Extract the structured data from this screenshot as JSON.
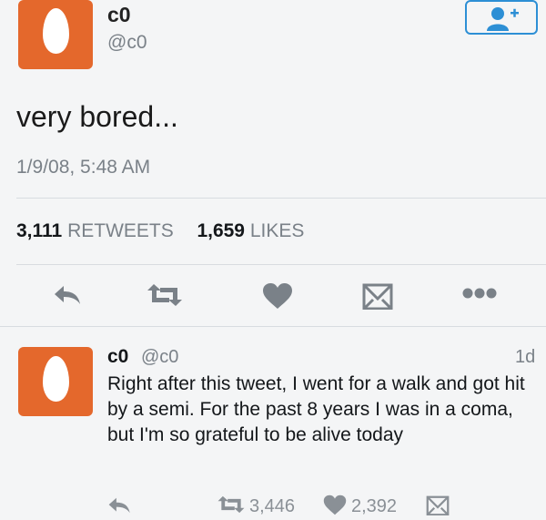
{
  "tweet": {
    "name": "c0",
    "handle": "@c0",
    "text": "very bored...",
    "timestamp": "1/9/08, 5:48 AM",
    "retweets_count": "3,111",
    "retweets_label": "RETWEETS",
    "likes_count": "1,659",
    "likes_label": "LIKES"
  },
  "reply": {
    "name": "c0",
    "handle": "@c0",
    "time": "1d",
    "text": "Right after this tweet, I went for a walk and got hit by a semi. For the past 8 years I was in a coma, but I'm so grateful to be alive today",
    "retweet_count": "3,446",
    "like_count": "2,392"
  },
  "colors": {
    "avatar": "#e4682c",
    "accent": "#2d8fd5",
    "icon": "#7a8188"
  },
  "icons": {
    "follow": "add-user-icon",
    "reply": "reply-icon",
    "retweet": "retweet-icon",
    "like": "heart-icon",
    "message": "envelope-icon",
    "more": "more-icon"
  }
}
